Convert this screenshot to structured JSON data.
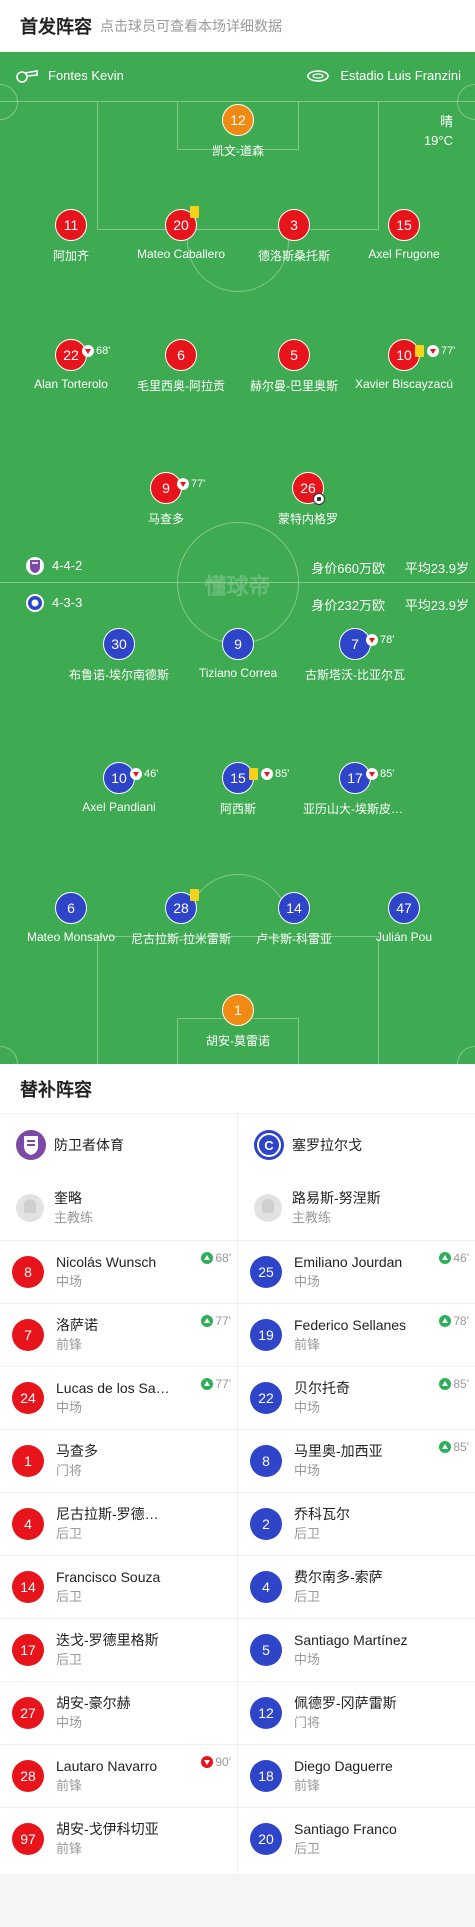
{
  "header": {
    "title": "首发阵容",
    "subtitle": "点击球员可查看本场详细数据"
  },
  "pitch": {
    "referee": "Fontes Kevin",
    "venue": "Estadio Luis Franzini",
    "weather": "晴",
    "temperature": "19°C",
    "watermark": "懂球帝",
    "colors": {
      "grass": "#3eaa51",
      "home": "#e8141b",
      "keeper": "#f08a12",
      "away": "#2e44c9"
    }
  },
  "home_team": {
    "name": "防卫者体育",
    "formation": "4-4-2",
    "value": "身价660万欧",
    "avg_age": "平均23.9岁"
  },
  "away_team": {
    "name": "塞罗拉尔戈",
    "formation": "4-3-3",
    "value": "身价232万欧",
    "avg_age": "平均23.9岁"
  },
  "home_lineup": [
    {
      "num": "12",
      "name": "凯文-道森",
      "kit": "keeper"
    },
    {
      "num": "11",
      "name": "阿加齐"
    },
    {
      "num": "20",
      "name": "Mateo Caballero",
      "card": "yellow"
    },
    {
      "num": "3",
      "name": "德洛斯桑托斯"
    },
    {
      "num": "15",
      "name": "Axel Frugone"
    },
    {
      "num": "22",
      "name": "Alan Torterolo",
      "sub_out": "68'"
    },
    {
      "num": "6",
      "name": "毛里西奥-阿拉贡"
    },
    {
      "num": "5",
      "name": "赫尔曼-巴里奥斯"
    },
    {
      "num": "10",
      "name": "Xavier Biscayzacú",
      "card": "yellow",
      "sub_out": "77'"
    },
    {
      "num": "9",
      "name": "马查多",
      "sub_out": "77'"
    },
    {
      "num": "26",
      "name": "蒙特内格罗",
      "goal": true
    }
  ],
  "away_lineup": [
    {
      "num": "30",
      "name": "布鲁诺-埃尔南德斯"
    },
    {
      "num": "9",
      "name": "Tiziano Correa"
    },
    {
      "num": "7",
      "name": "古斯塔沃-比亚尔瓦",
      "sub_out": "78'"
    },
    {
      "num": "10",
      "name": "Axel Pandiani",
      "sub_out": "46'"
    },
    {
      "num": "15",
      "name": "阿西斯",
      "card": "yellow",
      "sub_out": "85'"
    },
    {
      "num": "17",
      "name": "亚历山大-埃斯皮诺萨",
      "sub_out": "85'"
    },
    {
      "num": "6",
      "name": "Mateo Monsalvo"
    },
    {
      "num": "28",
      "name": "尼古拉斯-拉米雷斯",
      "card": "yellow"
    },
    {
      "num": "14",
      "name": "卢卡斯-科雷亚"
    },
    {
      "num": "47",
      "name": "Julián Pou"
    },
    {
      "num": "1",
      "name": "胡安-莫雷诺",
      "kit": "keeper"
    }
  ],
  "bench": {
    "title": "替补阵容",
    "coach_label": "主教练",
    "home": {
      "team": "防卫者体育",
      "coach": "奎略",
      "players": [
        {
          "num": "8",
          "name": "Nicolás Wunsch",
          "pos": "中场",
          "event": "68'",
          "type": "in"
        },
        {
          "num": "7",
          "name": "洛萨诺",
          "pos": "前锋",
          "event": "77'",
          "type": "in"
        },
        {
          "num": "24",
          "name": "Lucas de los Santos",
          "pos": "中场",
          "event": "77'",
          "type": "in"
        },
        {
          "num": "1",
          "name": "马查多",
          "pos": "门将"
        },
        {
          "num": "4",
          "name": "尼古拉斯-罗德里格斯",
          "pos": "后卫"
        },
        {
          "num": "14",
          "name": "Francisco Souza",
          "pos": "后卫"
        },
        {
          "num": "17",
          "name": "迭戈-罗德里格斯",
          "pos": "后卫"
        },
        {
          "num": "27",
          "name": "胡安-豪尔赫",
          "pos": "中场"
        },
        {
          "num": "28",
          "name": "Lautaro Navarro",
          "pos": "前锋",
          "event": "90'",
          "type": "out"
        },
        {
          "num": "97",
          "name": "胡安-戈伊科切亚",
          "pos": "前锋"
        }
      ]
    },
    "away": {
      "team": "塞罗拉尔戈",
      "coach": "路易斯-努涅斯",
      "players": [
        {
          "num": "25",
          "name": "Emiliano Jourdan",
          "pos": "中场",
          "event": "46'",
          "type": "in"
        },
        {
          "num": "19",
          "name": "Federico Sellanes",
          "pos": "前锋",
          "event": "78'",
          "type": "in"
        },
        {
          "num": "22",
          "name": "贝尔托奇",
          "pos": "中场",
          "event": "85'",
          "type": "in"
        },
        {
          "num": "8",
          "name": "马里奥-加西亚",
          "pos": "中场",
          "event": "85'",
          "type": "in"
        },
        {
          "num": "2",
          "name": "乔科瓦尔",
          "pos": "后卫"
        },
        {
          "num": "4",
          "name": "费尔南多-索萨",
          "pos": "后卫"
        },
        {
          "num": "5",
          "name": "Santiago Martínez",
          "pos": "中场"
        },
        {
          "num": "12",
          "name": "佩德罗-冈萨雷斯",
          "pos": "门将"
        },
        {
          "num": "18",
          "name": "Diego Daguerre",
          "pos": "前锋"
        },
        {
          "num": "20",
          "name": "Santiago Franco",
          "pos": "后卫"
        }
      ]
    }
  }
}
